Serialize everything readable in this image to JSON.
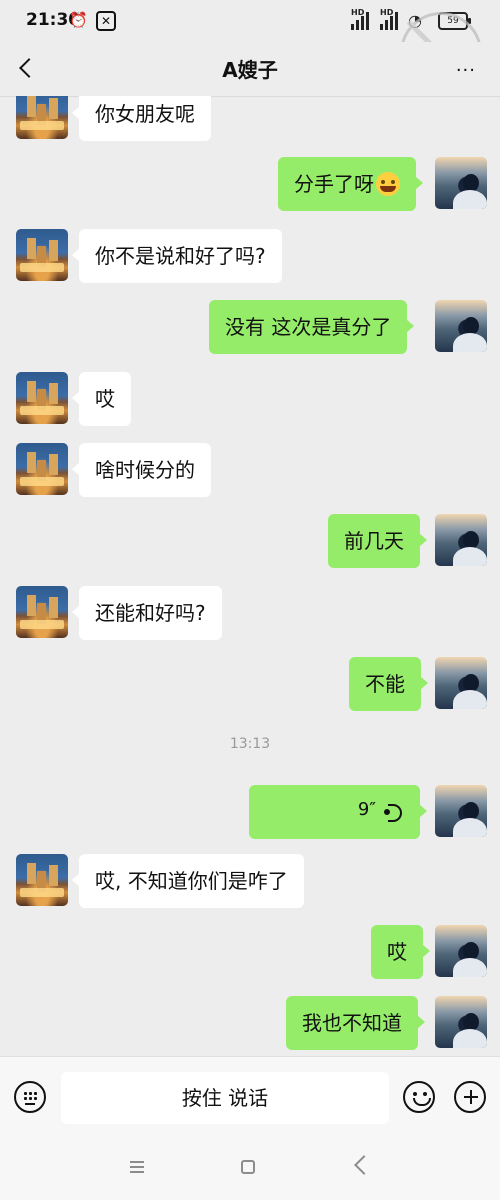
{
  "status_bar": {
    "time": "21:30",
    "battery": "59",
    "network_label_1": "HD",
    "network_label_2": "HD"
  },
  "header": {
    "title": "A嫂子",
    "more_label": "···"
  },
  "messages": [
    {
      "side": "left",
      "text": "你女朋友呢"
    },
    {
      "side": "right",
      "text": "分手了呀"
    },
    {
      "side": "left",
      "text": "你不是说和好了吗?"
    },
    {
      "side": "right",
      "text": "没有  这次是真分了"
    },
    {
      "side": "left",
      "text": "哎"
    },
    {
      "side": "left",
      "text": "啥时候分的"
    },
    {
      "side": "right",
      "text": "前几天"
    },
    {
      "side": "left",
      "text": "还能和好吗?"
    },
    {
      "side": "right",
      "text": "不能"
    },
    {
      "side": "left",
      "text": "哎, 不知道你们是咋了"
    },
    {
      "side": "right",
      "text": "哎"
    },
    {
      "side": "right",
      "text": "我也不知道"
    }
  ],
  "timestamp": "13:13",
  "voice_message": {
    "duration": "9″"
  },
  "composer": {
    "voice_label": "按住 说话"
  },
  "colors": {
    "background": "#ededed",
    "sent_bubble": "#95ec69",
    "received_bubble": "#ffffff"
  },
  "icons": [
    "back-icon",
    "more-icon",
    "voice-icon",
    "keyboard-icon",
    "emoji-icon",
    "plus-icon",
    "menu-icon",
    "home-icon",
    "back-nav-icon"
  ]
}
